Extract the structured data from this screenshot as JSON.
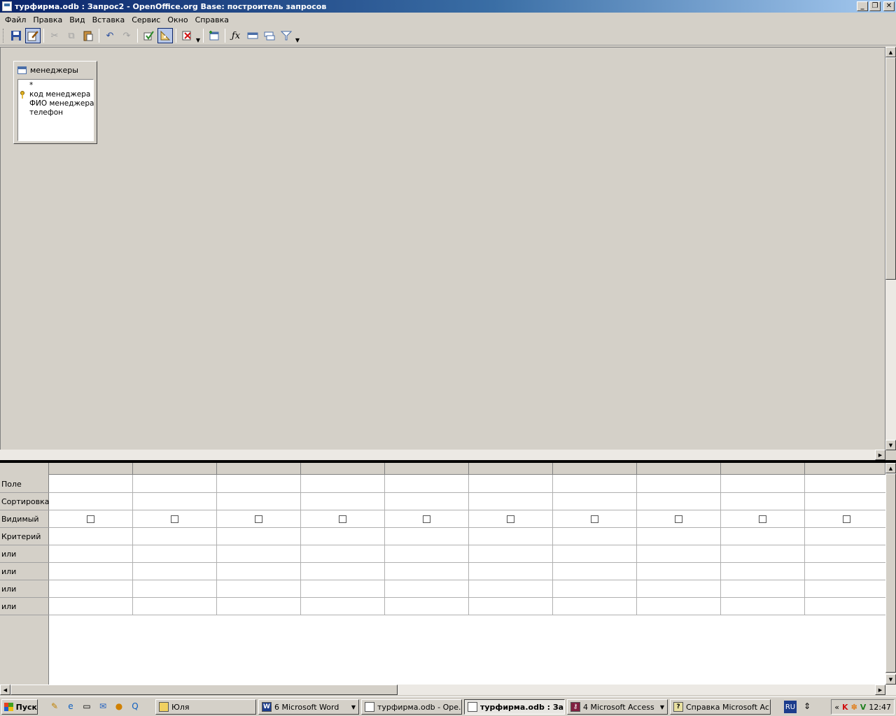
{
  "window": {
    "title": "турфирма.odb : Запрос2 - OpenOffice.org Base: построитель запросов",
    "caption_buttons": [
      "_",
      "❐",
      "✕"
    ]
  },
  "menu": [
    "Файл",
    "Правка",
    "Вид",
    "Вставка",
    "Сервис",
    "Окно",
    "Справка"
  ],
  "toolbar": {
    "icons": [
      "save-icon",
      "edit-icon",
      "cut-icon",
      "copy-icon",
      "paste-icon",
      "undo-icon",
      "redo-icon",
      "run-query-icon",
      "design-view-icon",
      "clear-icon",
      "add-table-icon",
      "functions-icon",
      "field-names-icon",
      "table-names-icon",
      "distinct-icon"
    ]
  },
  "table_window": {
    "title": "менеджеры",
    "fields": [
      "*",
      "код менеджера",
      "ФИО менеджера",
      "телефон"
    ],
    "key_field": "код менеджера"
  },
  "grid": {
    "row_labels": [
      "Поле",
      "Сортировка",
      "Видимый",
      "Критерий",
      "или",
      "или",
      "или",
      "или"
    ],
    "column_count": 10
  },
  "taskbar": {
    "start_label": "Пуск",
    "tasks": [
      {
        "label": "Юля",
        "icon": "folder-icon"
      },
      {
        "label": "6 Microsoft Word",
        "icon": "word-icon"
      },
      {
        "label": "турфирма.odb - Ope...",
        "icon": "base-icon"
      },
      {
        "label": "турфирма.odb : За...",
        "icon": "base-icon",
        "active": true
      },
      {
        "label": "4 Microsoft Access",
        "icon": "access-icon"
      },
      {
        "label": "Справка Microsoft Ac...",
        "icon": "help-icon"
      }
    ],
    "language": "RU",
    "clock": "12:47"
  },
  "colors": {
    "titlebar_start": "#0a246a",
    "titlebar_end": "#a6caf0",
    "face": "#d4d0c8"
  }
}
